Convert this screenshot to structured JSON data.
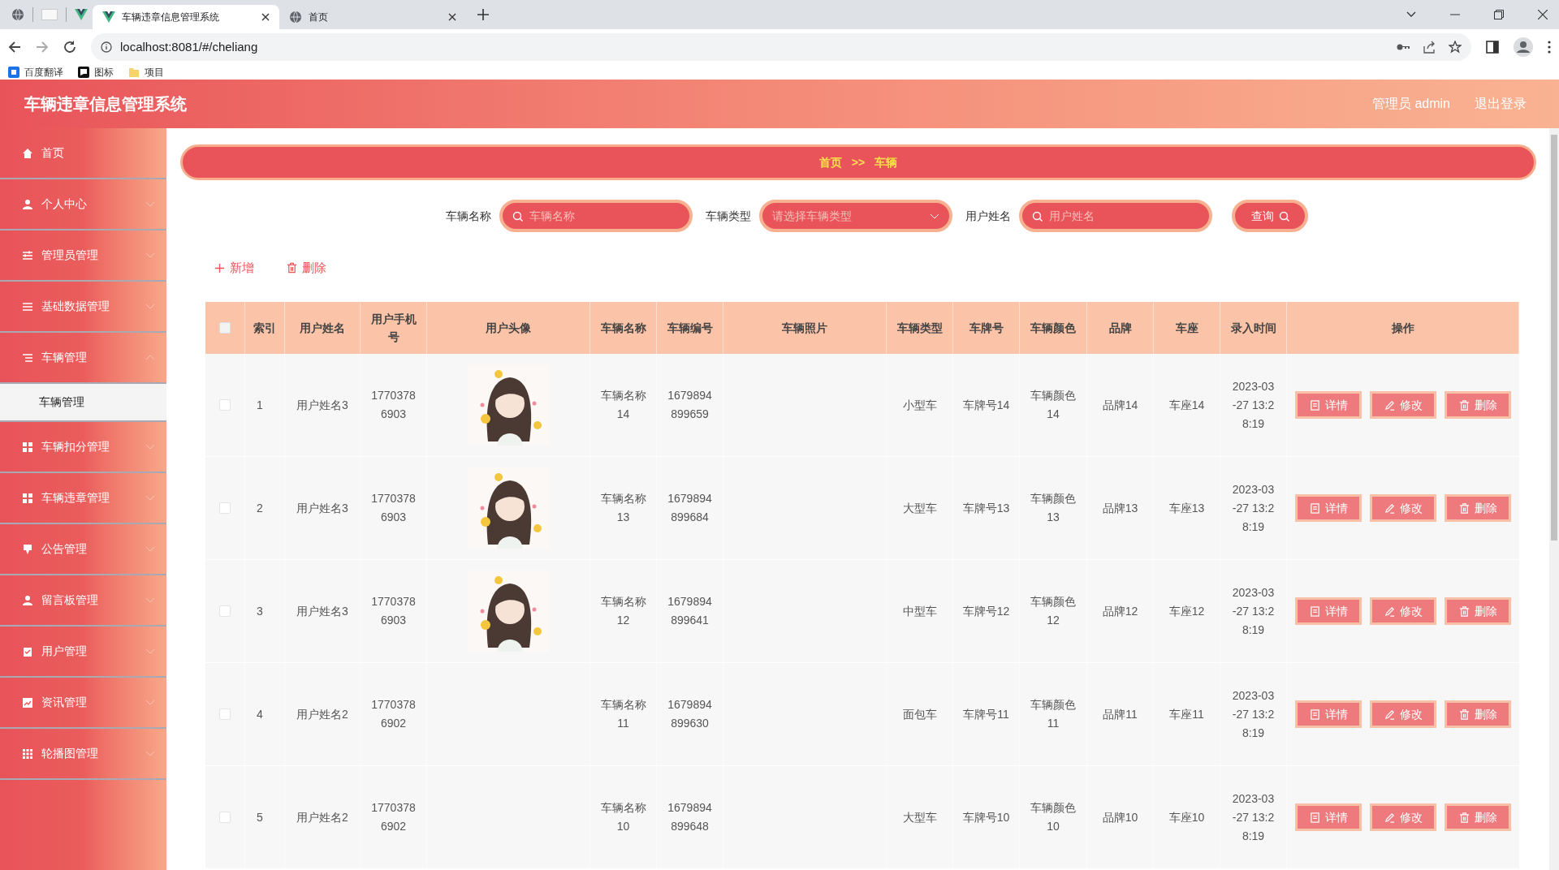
{
  "browser": {
    "tabs": [
      {
        "title": "车辆违章信息管理系统",
        "selected": true
      },
      {
        "title": "首页",
        "selected": false
      }
    ],
    "url": "localhost:8081/#/cheliang",
    "bookmarks": [
      "百度翻译",
      "图标",
      "项目"
    ]
  },
  "header": {
    "title": "车辆违章信息管理系统",
    "user": "管理员 admin",
    "logout": "退出登录"
  },
  "sidebar": {
    "items": [
      {
        "label": "首页",
        "has_submenu": false
      },
      {
        "label": "个人中心",
        "has_submenu": true,
        "expanded": false
      },
      {
        "label": "管理员管理",
        "has_submenu": true,
        "expanded": false
      },
      {
        "label": "基础数据管理",
        "has_submenu": true,
        "expanded": false
      },
      {
        "label": "车辆管理",
        "has_submenu": true,
        "expanded": true,
        "children": [
          {
            "label": "车辆管理",
            "selected": true
          }
        ]
      },
      {
        "label": "车辆扣分管理",
        "has_submenu": true,
        "expanded": false
      },
      {
        "label": "车辆违章管理",
        "has_submenu": true,
        "expanded": false
      },
      {
        "label": "公告管理",
        "has_submenu": true,
        "expanded": false
      },
      {
        "label": "留言板管理",
        "has_submenu": true,
        "expanded": false
      },
      {
        "label": "用户管理",
        "has_submenu": true,
        "expanded": false
      },
      {
        "label": "资讯管理",
        "has_submenu": true,
        "expanded": false
      },
      {
        "label": "轮播图管理",
        "has_submenu": true,
        "expanded": false
      }
    ]
  },
  "breadcrumb": {
    "items": [
      "首页",
      "车辆"
    ],
    "separator": ">>"
  },
  "search": {
    "fields": [
      {
        "label": "车辆名称",
        "kind": "input",
        "placeholder": "车辆名称"
      },
      {
        "label": "车辆类型",
        "kind": "select",
        "placeholder": "请选择车辆类型"
      },
      {
        "label": "用户姓名",
        "kind": "input",
        "placeholder": "用户姓名"
      }
    ],
    "button": "查询"
  },
  "actions": [
    {
      "label": "新增",
      "kind": "add"
    },
    {
      "label": "删除",
      "kind": "delete"
    }
  ],
  "table": {
    "select_all": false,
    "columns": [
      "索引",
      "用户姓名",
      "用户手机号",
      "用户头像",
      "车辆名称",
      "车辆编号",
      "车辆照片",
      "车辆类型",
      "车牌号",
      "车辆颜色",
      "品牌",
      "车座",
      "录入时间",
      "操作"
    ],
    "rows": [
      {
        "checked": false,
        "index": "1",
        "user_name": "用户姓名3",
        "phone": "17703786903",
        "has_avatar": true,
        "vehicle_name": "车辆名称14",
        "vehicle_no": "1679894899659",
        "vehicle_type": "小型车",
        "plate": "车牌号14",
        "vehicle_color": "车辆颜色14",
        "brand": "品牌14",
        "seats": "车座14",
        "time": "2023-03-27 13:28:19",
        "buttons": [
          "详情",
          "修改",
          "删除"
        ]
      },
      {
        "checked": false,
        "index": "2",
        "user_name": "用户姓名3",
        "phone": "17703786903",
        "has_avatar": true,
        "vehicle_name": "车辆名称13",
        "vehicle_no": "1679894899684",
        "vehicle_type": "大型车",
        "plate": "车牌号13",
        "vehicle_color": "车辆颜色13",
        "brand": "品牌13",
        "seats": "车座13",
        "time": "2023-03-27 13:28:19",
        "buttons": [
          "详情",
          "修改",
          "删除"
        ]
      },
      {
        "checked": false,
        "index": "3",
        "user_name": "用户姓名3",
        "phone": "17703786903",
        "has_avatar": true,
        "vehicle_name": "车辆名称12",
        "vehicle_no": "1679894899641",
        "vehicle_type": "中型车",
        "plate": "车牌号12",
        "vehicle_color": "车辆颜色12",
        "brand": "品牌12",
        "seats": "车座12",
        "time": "2023-03-27 13:28:19",
        "buttons": [
          "详情",
          "修改",
          "删除"
        ]
      },
      {
        "checked": false,
        "index": "4",
        "user_name": "用户姓名2",
        "phone": "17703786902",
        "has_avatar": false,
        "vehicle_name": "车辆名称11",
        "vehicle_no": "1679894899630",
        "vehicle_type": "面包车",
        "plate": "车牌号11",
        "vehicle_color": "车辆颜色11",
        "brand": "品牌11",
        "seats": "车座11",
        "time": "2023-03-27 13:28:19",
        "buttons": [
          "详情",
          "修改",
          "删除"
        ]
      },
      {
        "checked": false,
        "index": "5",
        "user_name": "用户姓名2",
        "phone": "17703786902",
        "has_avatar": false,
        "vehicle_name": "车辆名称10",
        "vehicle_no": "1679894899648",
        "vehicle_type": "大型车",
        "plate": "车牌号10",
        "vehicle_color": "车辆颜色10",
        "brand": "品牌10",
        "seats": "车座10",
        "time": "2023-03-27 13:28:19",
        "buttons": [
          "详情",
          "修改",
          "删除"
        ]
      }
    ]
  }
}
